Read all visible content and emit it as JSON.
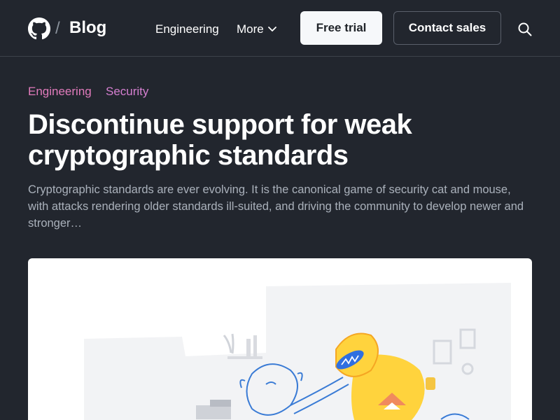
{
  "header": {
    "logo_icon": "github-octocat-icon",
    "separator": "/",
    "blog_label": "Blog",
    "nav": {
      "engineering_label": "Engineering",
      "more_label": "More",
      "more_icon": "chevron-down-icon"
    },
    "free_trial_label": "Free trial",
    "contact_sales_label": "Contact sales",
    "search_icon": "search-icon"
  },
  "article": {
    "tags": [
      {
        "label": "Engineering",
        "color": "#e17bbc"
      },
      {
        "label": "Security",
        "color": "#d57fd0"
      }
    ],
    "title": "Discontinue support for weak cryptographic standards",
    "excerpt": "Cryptographic standards are ever evolving. It is the canonical game of security cat and mouse, with attacks rendering older standards ill-suited, and driving the community to develop newer and stronger…",
    "hero_image": "octocat-illustration-image"
  },
  "colors": {
    "background": "#22262e",
    "free_trial_bg": "#f6f8fa",
    "excerpt_text": "#aab1bb"
  }
}
